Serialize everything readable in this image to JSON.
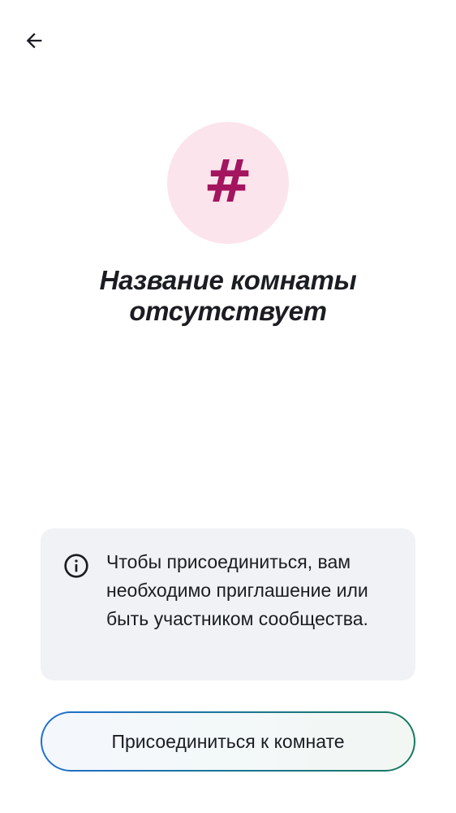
{
  "header": {
    "back_icon": "arrow-left-icon"
  },
  "room": {
    "avatar_glyph": "#",
    "avatar_bg": "#fce4ec",
    "avatar_fg": "#a3155f",
    "title": "Название комнаты отсутствует"
  },
  "info": {
    "icon": "info-icon",
    "text": "Чтобы присоединиться, вам необходимо приглашение или быть участником сообщества."
  },
  "actions": {
    "join_label": "Присоединиться к комнате",
    "border_gradient": [
      "#1f6fd1",
      "#167a5c"
    ]
  }
}
